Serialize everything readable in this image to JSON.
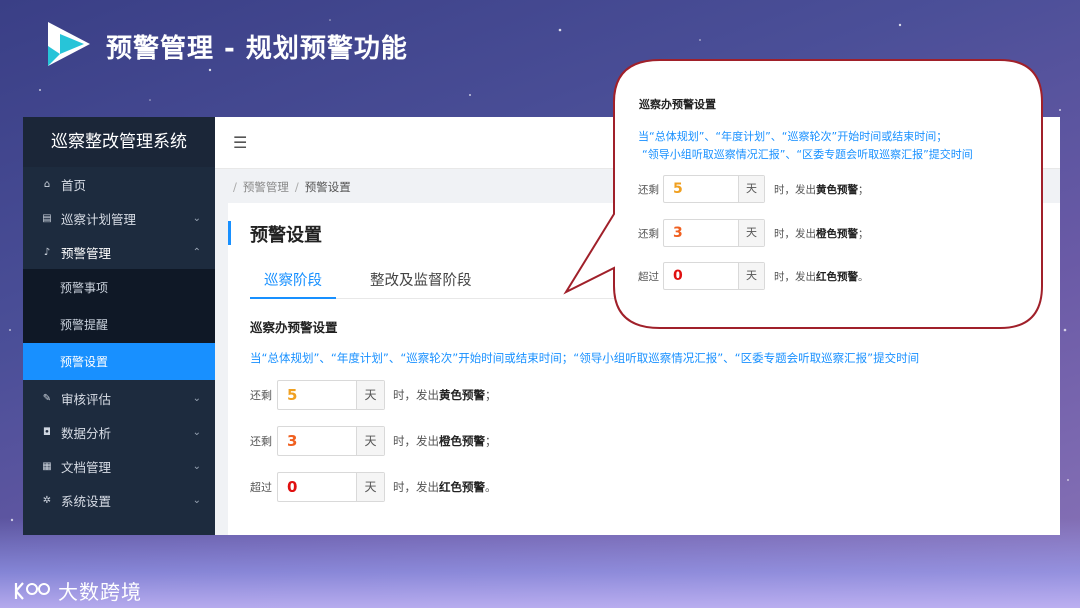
{
  "slide": {
    "title": "预警管理 - 规划预警功能"
  },
  "app": {
    "system_title": "巡察整改管理系统",
    "menu": [
      {
        "label": "首页",
        "icon": "home-icon",
        "chevron": ""
      },
      {
        "label": "巡察计划管理",
        "icon": "list-icon",
        "chevron": "⌄"
      },
      {
        "label": "预警管理",
        "icon": "bell-icon",
        "chevron": "⌃"
      }
    ],
    "submenu": [
      {
        "label": "预警事项"
      },
      {
        "label": "预警提醒"
      },
      {
        "label": "预警设置"
      }
    ],
    "menu_after": [
      {
        "label": "审核评估",
        "icon": "edit-icon",
        "chevron": "⌄"
      },
      {
        "label": "数据分析",
        "icon": "chart-icon",
        "chevron": "⌄"
      },
      {
        "label": "文档管理",
        "icon": "document-icon",
        "chevron": "⌄"
      },
      {
        "label": "系统设置",
        "icon": "gear-icon",
        "chevron": "⌄"
      }
    ],
    "breadcrumb": [
      "预警管理",
      "预警设置"
    ],
    "page_title": "预警设置",
    "tabs": [
      "巡察阶段",
      "整改及监督阶段"
    ],
    "section_title": "巡察办预警设置",
    "rule_text": "当“总体规划”、“年度计划”、“巡察轮次”开始时间或结束时间；“领导小组听取巡察情况汇报”、“区委专题会听取巡察汇报”提交时间",
    "rules": [
      {
        "label": "还剩",
        "value": "5",
        "unit": "天",
        "desc_prefix": "时，发出",
        "level": "黄色预警",
        "desc_suffix": "；"
      },
      {
        "label": "还剩",
        "value": "3",
        "unit": "天",
        "desc_prefix": "时，发出",
        "level": "橙色预警",
        "desc_suffix": "；"
      },
      {
        "label": "超过",
        "value": "0",
        "unit": "天",
        "desc_prefix": "时，发出",
        "level": "红色预警",
        "desc_suffix": "。"
      }
    ]
  },
  "callout": {
    "title": "巡察办预警设置",
    "rule_line1": "当“总体规划”、“年度计划”、“巡察轮次”开始时间或结束时间；",
    "rule_line2": "“领导小组听取巡察情况汇报”、“区委专题会听取巡察汇报”提交时间"
  },
  "colors": {
    "accent": "#1890ff",
    "sidebar": "#1d2b3e",
    "yellow": "#f0a020",
    "orange": "#f06020",
    "red": "#e01010",
    "bubble_border": "#a0202a"
  },
  "watermark": {
    "text": "大数跨境"
  }
}
